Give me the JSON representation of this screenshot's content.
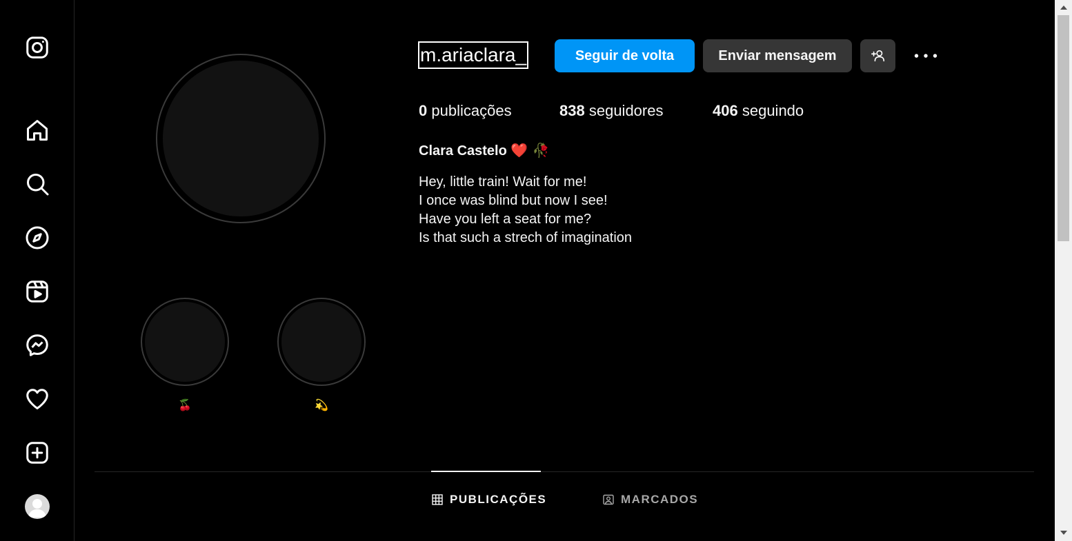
{
  "sidebar": {
    "items": [
      {
        "name": "instagram-logo-icon"
      },
      {
        "name": "home-icon"
      },
      {
        "name": "search-icon"
      },
      {
        "name": "explore-icon"
      },
      {
        "name": "reels-icon"
      },
      {
        "name": "messenger-icon"
      },
      {
        "name": "heart-icon"
      },
      {
        "name": "create-icon"
      },
      {
        "name": "profile-avatar"
      }
    ]
  },
  "profile": {
    "username": "m.ariaclara_",
    "full_name": "Clara Castelo",
    "name_emojis": "❤️ 🥀",
    "buttons": {
      "follow_back": "Seguir de volta",
      "message": "Enviar mensagem"
    },
    "stats": {
      "posts_count": "0",
      "posts_label": "publicações",
      "followers_count": "838",
      "followers_label": "seguidores",
      "following_count": "406",
      "following_label": "seguindo"
    },
    "bio": [
      "Hey, little train! Wait for me!",
      "I once was blind but now I see!",
      "Have you left a seat for me?",
      "Is that such a strech of imagination"
    ]
  },
  "highlights": [
    {
      "label": "🍒"
    },
    {
      "label": "💫"
    }
  ],
  "tabs": {
    "posts": "PUBLICAÇÕES",
    "tagged": "MARCADOS"
  },
  "colors": {
    "background": "#000000",
    "primary_button": "#0095f6",
    "secondary_button": "#363636",
    "divider": "#262626"
  }
}
